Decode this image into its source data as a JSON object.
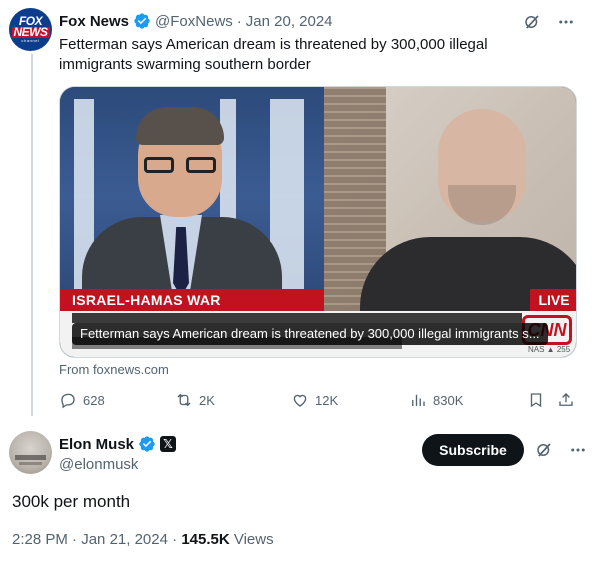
{
  "quoted": {
    "name": "Fox News",
    "handle": "@FoxNews",
    "separator": "·",
    "date": "Jan 20, 2024",
    "text": "Fetterman says American dream is threatened by 300,000 illegal immigrants swarming southern border",
    "avatar_text": [
      "FOX",
      "NEWS",
      "channel"
    ],
    "media": {
      "banner_left": "ISRAEL-HAMAS WAR",
      "banner_right": "LIVE",
      "caption": "Fetterman says American dream is threatened by 300,000 illegal immigrants s...",
      "logo": "CNN",
      "ticker": "NAS ▲ 255"
    },
    "source": "From foxnews.com",
    "stats": {
      "replies": "628",
      "reposts": "2K",
      "likes": "12K",
      "views": "830K"
    }
  },
  "main": {
    "name": "Elon Musk",
    "handle": "@elonmusk",
    "subscribe_label": "Subscribe",
    "text": "300k per month",
    "time": "2:28 PM",
    "separator": "·",
    "date": "Jan 21, 2024",
    "separator2": "·",
    "views_count": "145.5K",
    "views_label": "Views"
  },
  "colors": {
    "verified": "#1d9bf0",
    "text_primary": "#0f1419",
    "text_secondary": "#536471",
    "cnn_red": "#c3121f"
  },
  "icons": [
    "grok-icon",
    "more-icon",
    "reply-icon",
    "repost-icon",
    "like-icon",
    "views-icon",
    "bookmark-icon",
    "share-icon",
    "verified-badge-icon",
    "x-affiliate-icon"
  ]
}
